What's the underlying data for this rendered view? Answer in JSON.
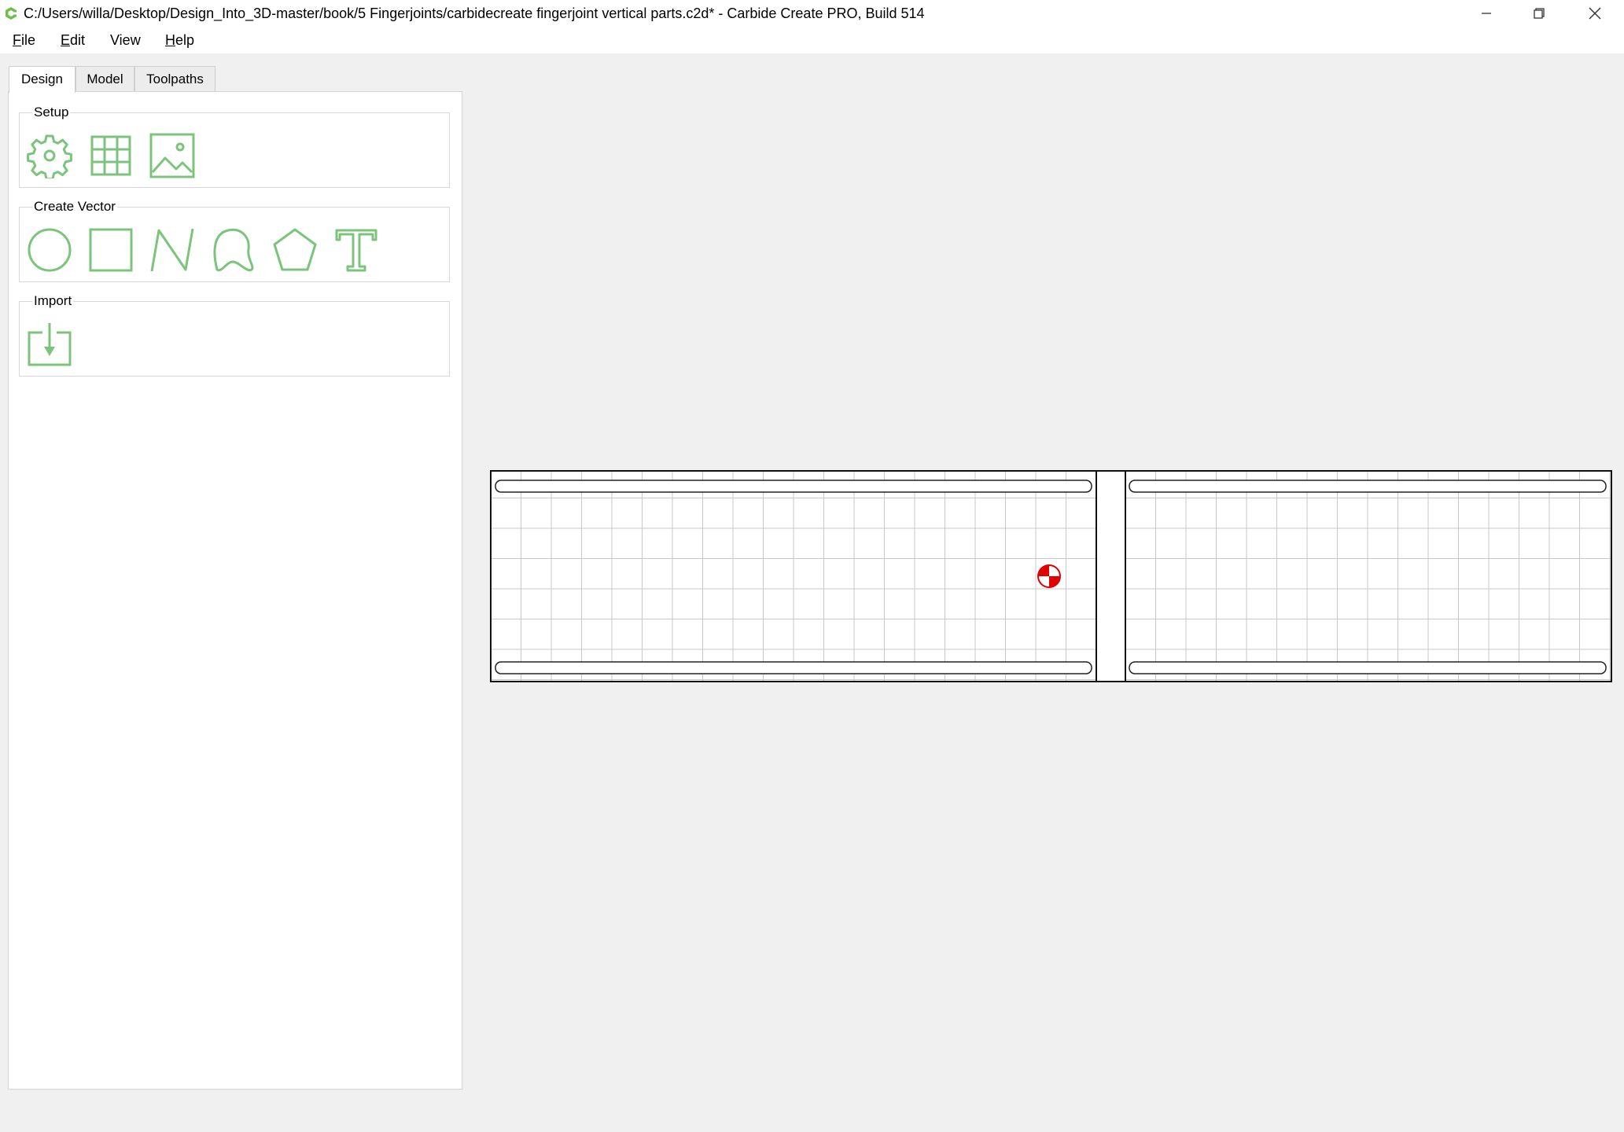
{
  "window": {
    "title": "C:/Users/willa/Desktop/Design_Into_3D-master/book/5 Fingerjoints/carbidecreate fingerjoint vertical parts.c2d* - Carbide Create PRO, Build 514"
  },
  "menu": {
    "file": {
      "label": "ile",
      "accel": "F"
    },
    "edit": {
      "label": "dit",
      "accel": "E"
    },
    "view": {
      "label": "View"
    },
    "help": {
      "label": "elp",
      "accel": "H"
    }
  },
  "tabs": [
    {
      "label": "Design",
      "active": true
    },
    {
      "label": "Model",
      "active": false
    },
    {
      "label": "Toolpaths",
      "active": false
    }
  ],
  "groups": {
    "setup": {
      "title": "Setup",
      "tools": [
        "gear-icon",
        "grid-icon",
        "image-icon"
      ]
    },
    "create_vector": {
      "title": "Create Vector",
      "tools": [
        "circle-icon",
        "rectangle-icon",
        "polyline-icon",
        "curve-icon",
        "polygon-icon",
        "text-icon"
      ]
    },
    "import": {
      "title": "Import",
      "tools": [
        "import-icon"
      ]
    }
  },
  "colors": {
    "accent_green": "#7cc47c",
    "origin_red": "#e00000"
  }
}
